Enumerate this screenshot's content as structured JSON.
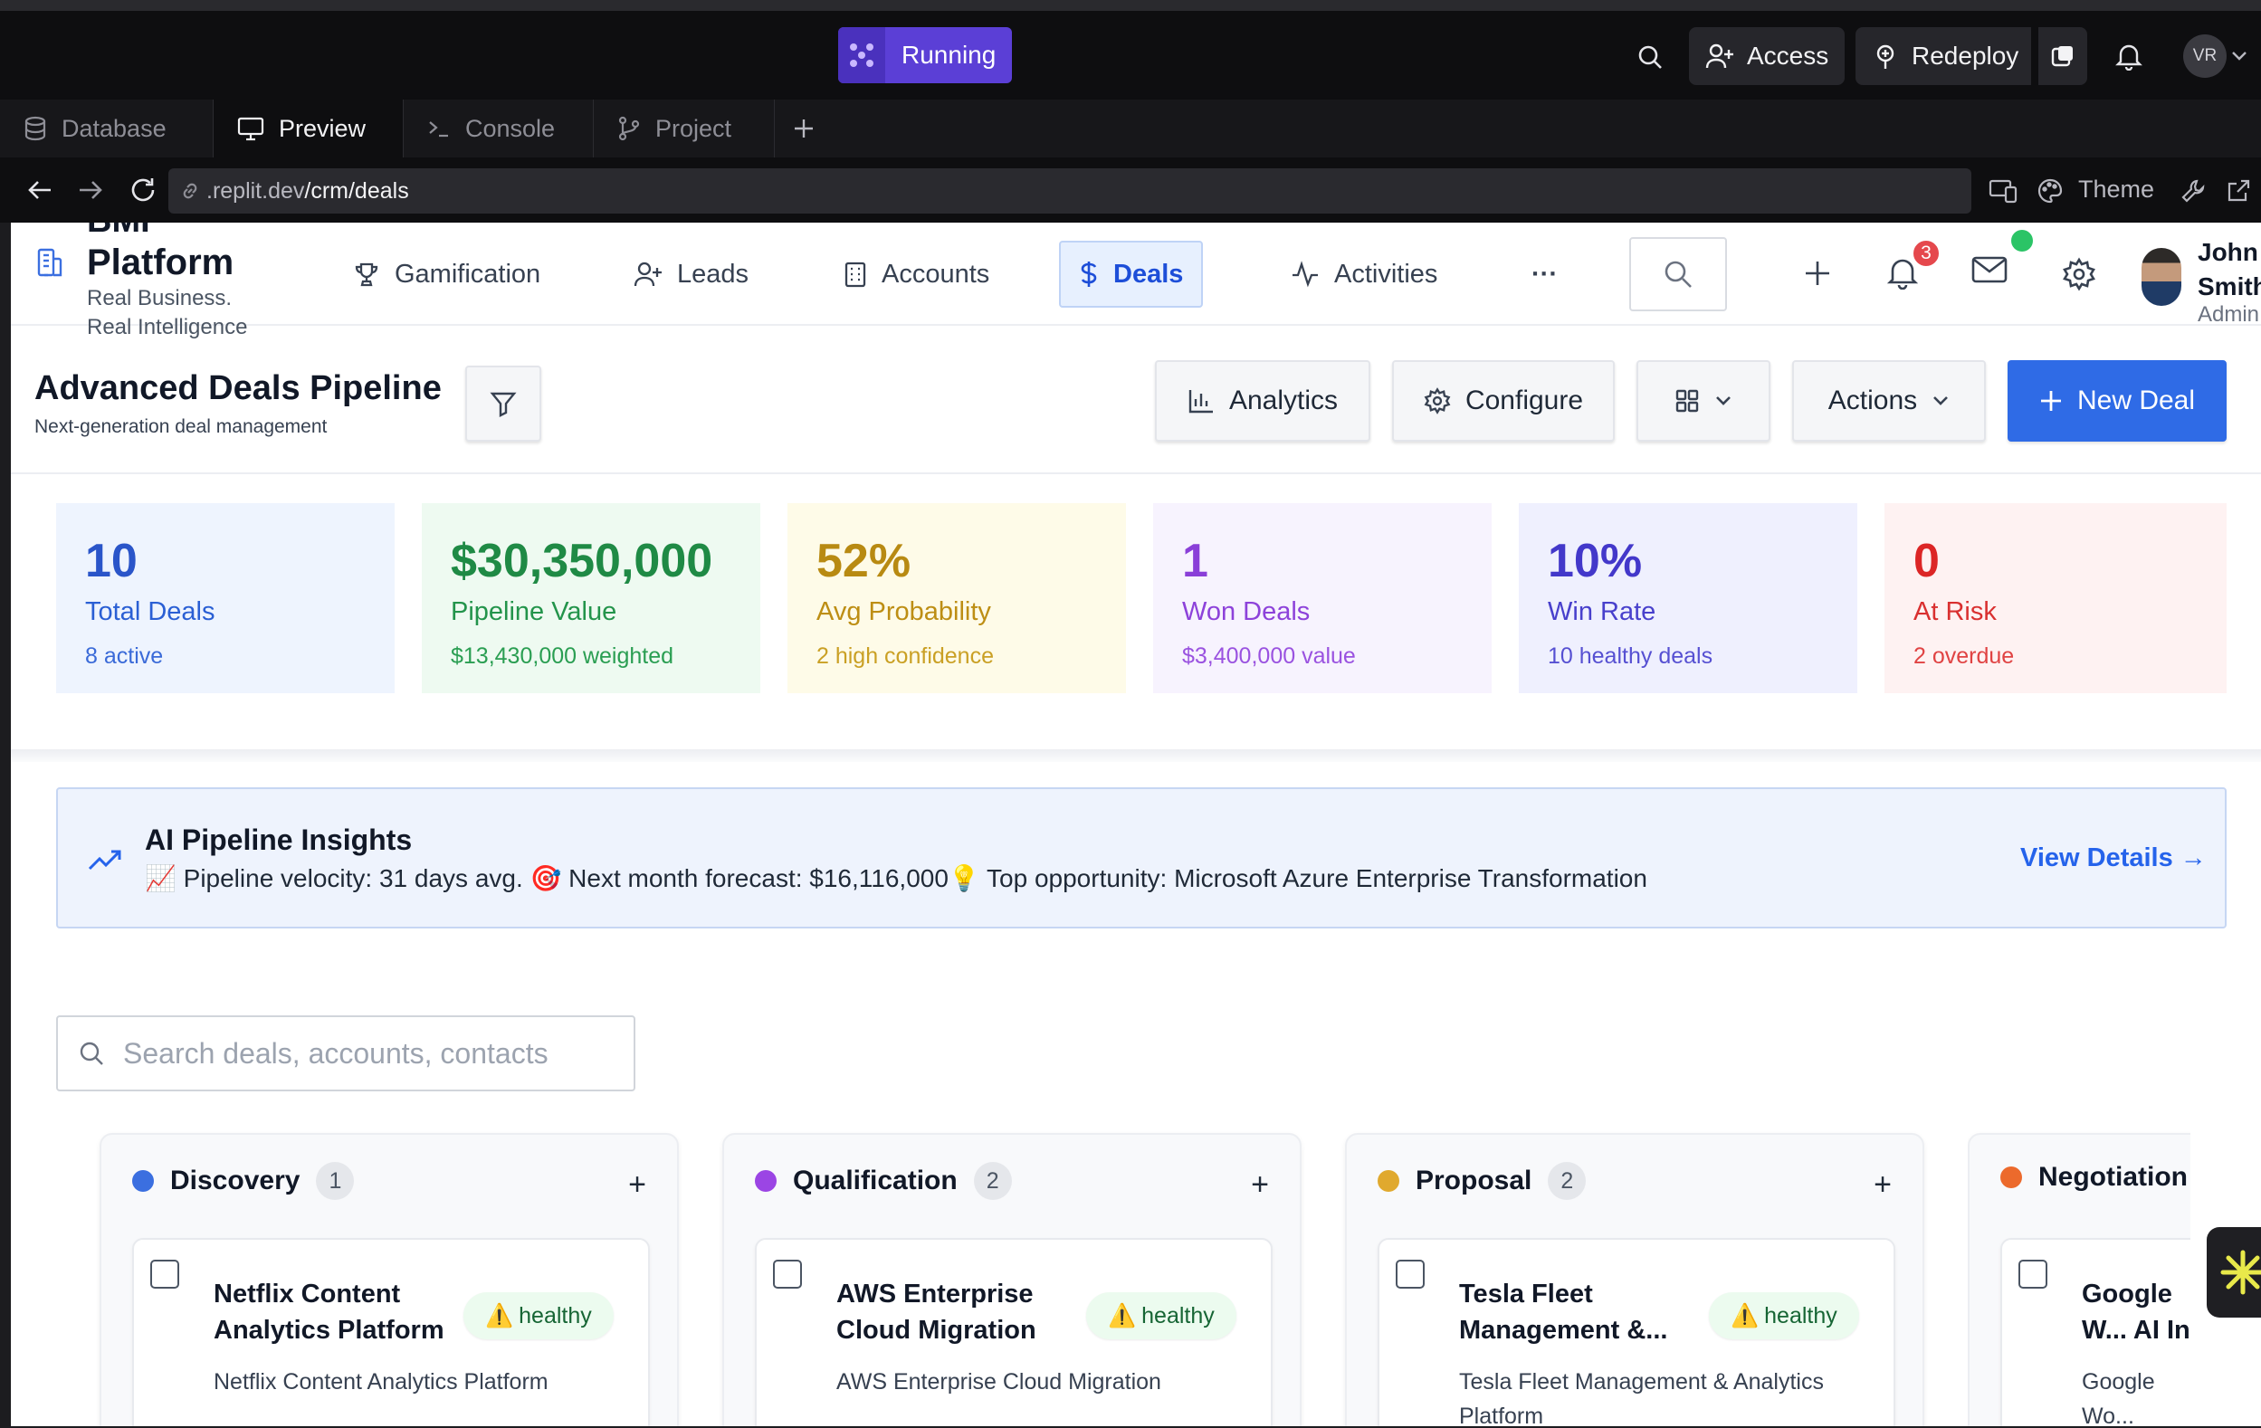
{
  "topbar": {
    "status_label": "Running",
    "access_label": "Access",
    "redeploy_label": "Redeploy",
    "avatar_initials": "VR"
  },
  "tabs": [
    {
      "label": "Database",
      "icon": "database-icon"
    },
    {
      "label": "Preview",
      "icon": "monitor-icon"
    },
    {
      "label": "Console",
      "icon": "terminal-icon"
    },
    {
      "label": "Project",
      "icon": "git-branch-icon"
    }
  ],
  "urlbar": {
    "url_prefix": ".replit.dev",
    "url_path": "/crm/deals",
    "theme_label": "Theme"
  },
  "brand": {
    "name_line1": "BMI",
    "name_line2": "Platform",
    "tagline1": "Real Business.",
    "tagline2": "Real Intelligence"
  },
  "nav": {
    "items": [
      {
        "label": "Gamification",
        "icon": "trophy-icon"
      },
      {
        "label": "Leads",
        "icon": "user-plus-icon"
      },
      {
        "label": "Accounts",
        "icon": "building-icon"
      },
      {
        "label": "Deals",
        "icon": "dollar-icon"
      },
      {
        "label": "Activities",
        "icon": "activity-icon"
      }
    ],
    "more_label": "···",
    "notification_count": "3",
    "user_name": "John Smith",
    "user_role": "Admin"
  },
  "page": {
    "title": "Advanced Deals Pipeline",
    "subtitle": "Next-generation deal management",
    "analytics_label": "Analytics",
    "configure_label": "Configure",
    "actions_label": "Actions",
    "new_deal_label": "New Deal"
  },
  "stats": [
    {
      "value": "10",
      "label": "Total Deals",
      "sub": "8 active"
    },
    {
      "value": "$30,350,000",
      "label": "Pipeline Value",
      "sub": "$13,430,000 weighted"
    },
    {
      "value": "52%",
      "label": "Avg Probability",
      "sub": "2 high confidence"
    },
    {
      "value": "1",
      "label": "Won Deals",
      "sub": "$3,400,000 value"
    },
    {
      "value": "10%",
      "label": "Win Rate",
      "sub": "10 healthy deals"
    },
    {
      "value": "0",
      "label": "At Risk",
      "sub": "2 overdue"
    }
  ],
  "insights": {
    "title": "AI Pipeline Insights",
    "text": "📈 Pipeline velocity: 31 days avg. 🎯 Next month forecast: $16,116,000💡 Top opportunity: Microsoft Azure Enterprise Transformation",
    "link_label": "View Details →"
  },
  "search": {
    "placeholder": "Search deals, accounts, contacts"
  },
  "columns": [
    {
      "name": "Discovery",
      "count": "1",
      "color": "#3b6fe0",
      "card": {
        "title": "Netflix Content Analytics Platform",
        "health": "healthy",
        "subtitle": "Netflix Content Analytics Platform"
      }
    },
    {
      "name": "Qualification",
      "count": "2",
      "color": "#9b45e4",
      "card": {
        "title": "AWS Enterprise Cloud Migration",
        "health": "healthy",
        "subtitle": "AWS Enterprise Cloud Migration"
      }
    },
    {
      "name": "Proposal",
      "count": "2",
      "color": "#e0a92e",
      "card": {
        "title": "Tesla Fleet Management &...",
        "health": "healthy",
        "subtitle": "Tesla Fleet Management & Analytics Platform"
      }
    },
    {
      "name": "Negotiation",
      "count": "",
      "color": "#ec6a2c",
      "card": {
        "title": "Google W... AI Integr...",
        "health": "",
        "subtitle": "Google Wo... Platform"
      }
    }
  ],
  "colors": {
    "accent": "#2563eb",
    "running": "#5b3fd6"
  }
}
